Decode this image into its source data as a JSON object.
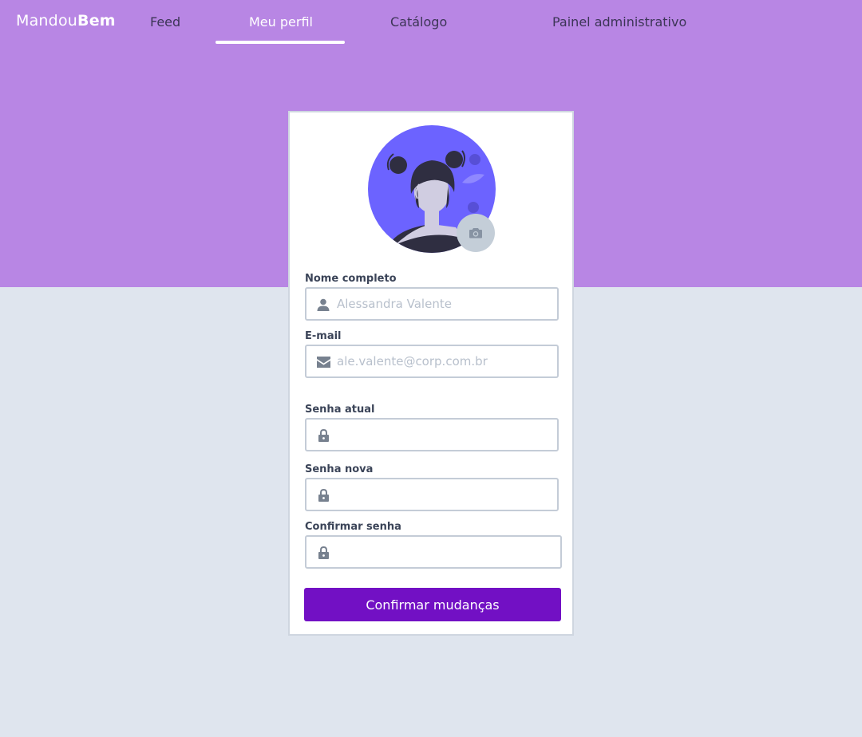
{
  "brand": {
    "part1": "Mandou",
    "part2": "Bem"
  },
  "nav": {
    "items": [
      {
        "label": "Feed",
        "active": false
      },
      {
        "label": "Meu perfil",
        "active": true
      },
      {
        "label": "Catálogo",
        "active": false
      },
      {
        "label": "Painel administrativo",
        "active": false
      }
    ]
  },
  "profile": {
    "avatar_icon": "person-avatar-illustration",
    "camera_icon": "camera-icon",
    "fields": {
      "name": {
        "label": "Nome completo",
        "placeholder": "Alessandra Valente",
        "value": "",
        "icon": "user-icon"
      },
      "email": {
        "label": "E-mail",
        "placeholder": "ale.valente@corp.com.br",
        "value": "",
        "icon": "envelope-icon"
      },
      "current_password": {
        "label": "Senha atual",
        "placeholder": "",
        "value": "",
        "icon": "lock-icon"
      },
      "new_password": {
        "label": "Senha nova",
        "placeholder": "",
        "value": "",
        "icon": "lock-icon"
      },
      "confirm_password": {
        "label": "Confirmar senha",
        "placeholder": "",
        "value": "",
        "icon": "lock-icon"
      }
    },
    "submit_label": "Confirmar mudanças"
  },
  "colors": {
    "hero": "#b886e4",
    "page_bg": "#dfe5ee",
    "primary_button": "#7210c4",
    "avatar_bg": "#6c63ff"
  }
}
